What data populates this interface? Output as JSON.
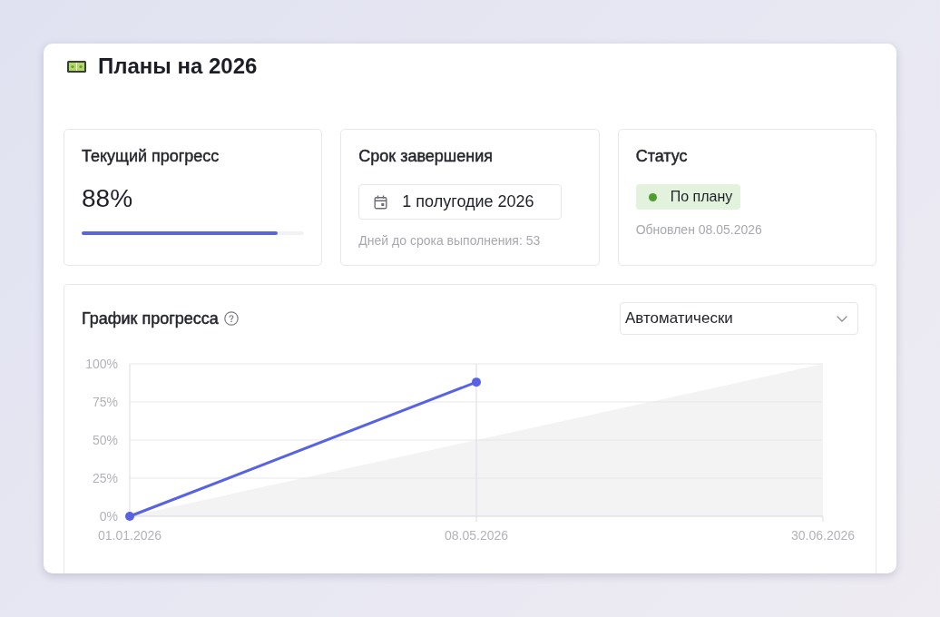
{
  "header": {
    "title": "Планы на 2026"
  },
  "progress_card": {
    "title": "Текущий прогресс",
    "value": "88%",
    "level": 0.88
  },
  "deadline_card": {
    "title": "Срок завершения",
    "date_field": {
      "value": "1 полугодие 2026"
    },
    "hint": "Дней до срока выполнения: 53"
  },
  "status_card": {
    "title": "Статус",
    "badge": {
      "label": "По плану",
      "kind": "success"
    },
    "updated": "Обновлен 08.05.2026"
  },
  "progress_chart": {
    "title": "График прогресса",
    "mode_select": {
      "value": "Автоматически"
    },
    "chart_data": {
      "type": "line",
      "categories": [
        "01.01.2026",
        "08.05.2026",
        "30.06.2026"
      ],
      "ylim": [
        0,
        100
      ],
      "yticks": [
        {
          "value": 100,
          "label": "100%"
        },
        {
          "value": 75,
          "label": "75%"
        },
        {
          "value": 50,
          "label": "50%"
        },
        {
          "value": 25,
          "label": "25%"
        },
        {
          "value": 0,
          "label": "0%"
        }
      ],
      "grid": true,
      "series": [
        {
          "type": "area",
          "color": "#f3f3f4",
          "values": [
            0,
            50,
            100
          ]
        },
        {
          "type": "line",
          "color": "#5763e4",
          "marker": "circle",
          "values": [
            0,
            88,
            null
          ]
        }
      ],
      "ref_lines": [
        {
          "axis": "x",
          "value": "08.05.2026",
          "color": "#e2e2e7"
        }
      ]
    }
  }
}
